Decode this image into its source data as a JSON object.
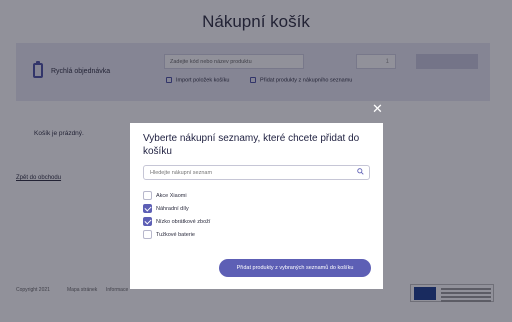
{
  "page": {
    "title": "Nákupní košík",
    "quick_order": {
      "label": "Rychlá objednávka",
      "product_value": "Zadejte kód nebo název produktu",
      "quantity_value": "1",
      "import_link": "Import položek košíku",
      "add_from_list_link": "Přidat produkty z nákupního seznamu"
    },
    "empty_message": "Košík je prázdný.",
    "back_link": "Zpět do obchodu",
    "footer": {
      "copyright": "Copyright 2021",
      "links": [
        "Mapa stránek",
        "Informace"
      ]
    }
  },
  "modal": {
    "title": "Vyberte nákupní seznamy, které chcete přidat do košíku",
    "search_placeholder": "Hledejte nákupní seznam",
    "lists": [
      {
        "label": "Akce Xiaomi",
        "checked": false
      },
      {
        "label": "Náhradní díly",
        "checked": true
      },
      {
        "label": "Nízko obrátkové zboží",
        "checked": true
      },
      {
        "label": "Tužkové baterie",
        "checked": false
      }
    ],
    "submit_label": "Přidat produkty z vybraných seznamů do košíku",
    "close_icon": "close-icon"
  },
  "colors": {
    "accent": "#5d5fb5",
    "panel": "#e9e9f4",
    "overlay": "rgba(26,26,44,0.48)"
  }
}
